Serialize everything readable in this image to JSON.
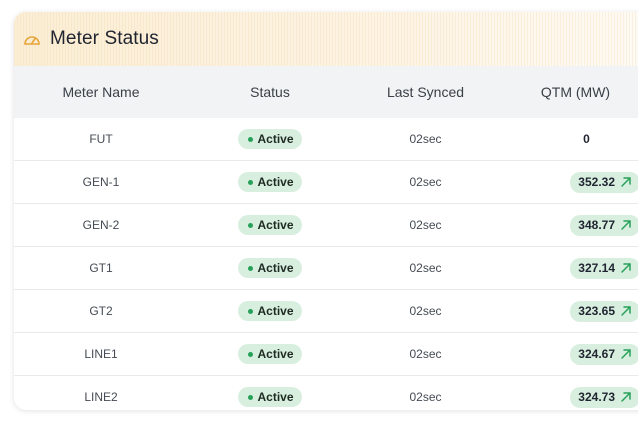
{
  "card": {
    "title": "Meter Status",
    "icon": "gauge-icon"
  },
  "columns": {
    "meter_name": "Meter Name",
    "status": "Status",
    "last_synced": "Last Synced",
    "qtm": "QTM (MW)"
  },
  "rows": [
    {
      "name": "FUT",
      "status": "Active",
      "synced": "02sec",
      "qtm": "0",
      "trend": null
    },
    {
      "name": "GEN-1",
      "status": "Active",
      "synced": "02sec",
      "qtm": "352.32",
      "trend": "up"
    },
    {
      "name": "GEN-2",
      "status": "Active",
      "synced": "02sec",
      "qtm": "348.77",
      "trend": "up"
    },
    {
      "name": "GT1",
      "status": "Active",
      "synced": "02sec",
      "qtm": "327.14",
      "trend": "up"
    },
    {
      "name": "GT2",
      "status": "Active",
      "synced": "02sec",
      "qtm": "323.65",
      "trend": "up"
    },
    {
      "name": "LINE1",
      "status": "Active",
      "synced": "02sec",
      "qtm": "324.67",
      "trend": "up"
    },
    {
      "name": "LINE2",
      "status": "Active",
      "synced": "02sec",
      "qtm": "324.73",
      "trend": "up"
    }
  ],
  "colors": {
    "accent": "#e8a43a",
    "status_bg": "#d8efdf",
    "status_dot": "#27a15a",
    "trend_arrow": "#27a15a"
  }
}
